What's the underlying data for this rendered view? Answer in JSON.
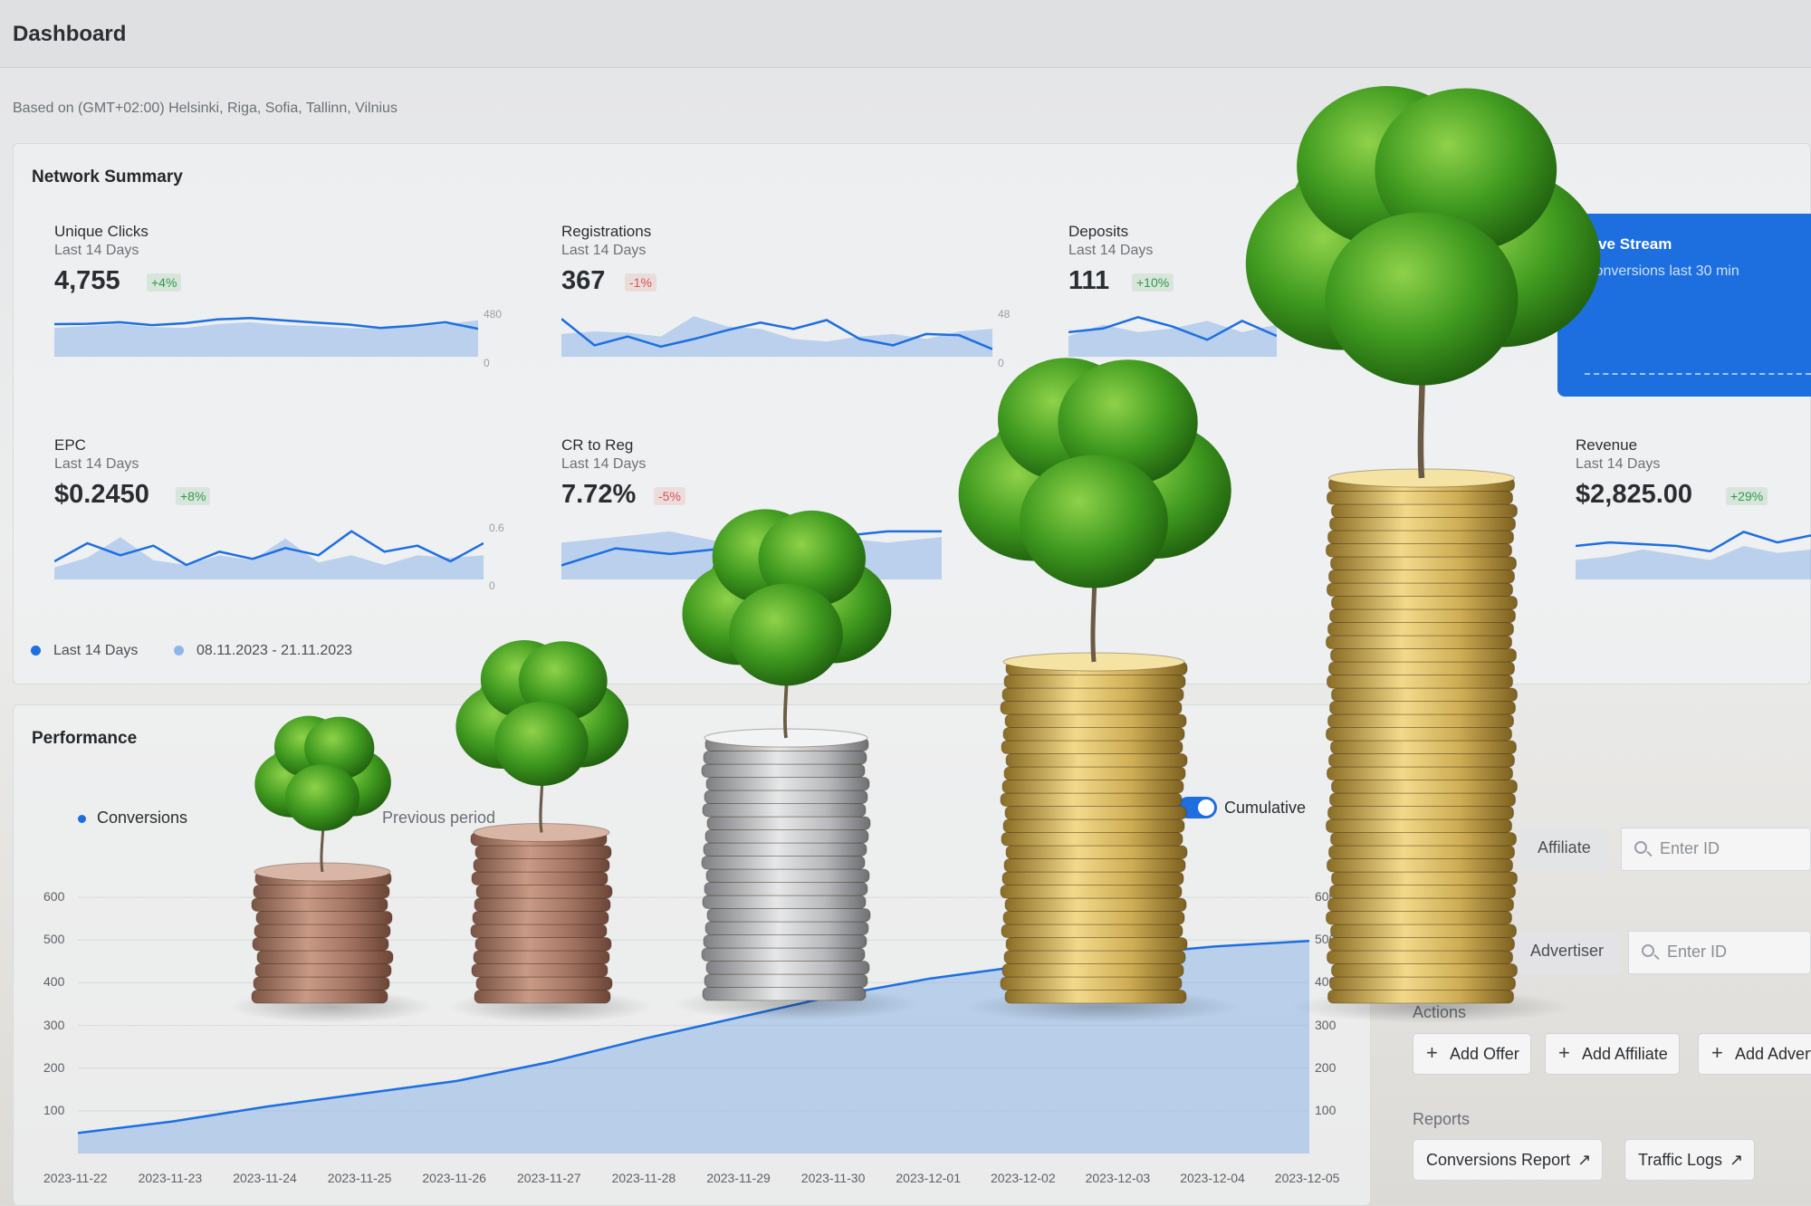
{
  "header": {
    "title": "Dashboard"
  },
  "timezone_note": "Based on (GMT+02:00) Helsinki, Riga, Sofia, Tallinn, Vilnius",
  "network_summary": {
    "title": "Network Summary",
    "metrics": [
      {
        "title": "Unique Clicks",
        "period": "Last 14 Days",
        "value": "4,755",
        "delta": "+4%",
        "trend": "up",
        "axis_max": "480",
        "axis_min": "0",
        "series_current": [
          320,
          322,
          330,
          315,
          325,
          345,
          352,
          340,
          328,
          318,
          300,
          312,
          330,
          295
        ],
        "series_previous": [
          300,
          310,
          320,
          305,
          300,
          320,
          330,
          315,
          310,
          300,
          295,
          305,
          320,
          340
        ]
      },
      {
        "title": "Registrations",
        "period": "Last 14 Days",
        "value": "367",
        "delta": "-1%",
        "trend": "down",
        "axis_max": "48",
        "axis_min": "0",
        "series_current": [
          36,
          15,
          22,
          14,
          20,
          27,
          33,
          28,
          35,
          20,
          15,
          24,
          23,
          12
        ],
        "series_previous": [
          24,
          26,
          25,
          22,
          38,
          30,
          28,
          20,
          18,
          22,
          24,
          20,
          26,
          28
        ]
      },
      {
        "title": "Deposits",
        "period": "Last 14 Days",
        "value": "111",
        "delta": "+10%",
        "trend": "up",
        "axis_max": "",
        "axis_min": "",
        "series_current": [
          22,
          24,
          30,
          25,
          18,
          28,
          20
        ],
        "series_previous": [
          20,
          26,
          22,
          24,
          28,
          22,
          26
        ]
      },
      {
        "title": "EPC",
        "period": "Last 14 Days",
        "value": "$0.2450",
        "delta": "+8%",
        "trend": "up",
        "axis_max": "0.6",
        "axis_min": "0",
        "series_current": [
          0.25,
          0.4,
          0.3,
          0.38,
          0.22,
          0.33,
          0.27,
          0.36,
          0.3,
          0.5,
          0.33,
          0.38,
          0.25,
          0.4
        ],
        "series_previous": [
          0.2,
          0.28,
          0.45,
          0.26,
          0.22,
          0.3,
          0.26,
          0.44,
          0.24,
          0.3,
          0.22,
          0.3,
          0.28,
          0.3
        ]
      },
      {
        "title": "CR to Reg",
        "period": "Last 14 Days",
        "value": "7.72%",
        "delta": "-5%",
        "trend": "down",
        "axis_max": "",
        "axis_min": "",
        "series_current": [
          5,
          8,
          7,
          8,
          9,
          10,
          11,
          11
        ],
        "series_previous": [
          9,
          10,
          11,
          9,
          8,
          10,
          9,
          10
        ]
      },
      {
        "title": "Revenue",
        "period": "Last 14 Days",
        "value": "$2,825.00",
        "delta": "+29%",
        "trend": "up",
        "axis_max": "80",
        "axis_min": "0",
        "series_current": [
          30,
          32,
          31,
          30,
          27,
          38,
          32,
          36
        ],
        "series_previous": [
          22,
          24,
          28,
          25,
          22,
          30,
          26,
          28
        ]
      }
    ],
    "legend": [
      {
        "label": "Last 14 Days",
        "color": "#1d6fe0"
      },
      {
        "label": "08.11.2023 - 21.11.2023",
        "color": "#8fb6e8"
      }
    ]
  },
  "live_stream": {
    "title": "Live Stream",
    "subtitle": "Conversions last 30 min"
  },
  "performance": {
    "title": "Performance",
    "legend_conversions": "Conversions",
    "legend_previous": "Previous period",
    "cumulative_label": "Cumulative",
    "cumulative_on": true,
    "y_ticks": [
      "600",
      "500",
      "400",
      "300",
      "200",
      "100"
    ],
    "y2_ticks": [
      "600",
      "500",
      "400",
      "300",
      "200",
      "100"
    ],
    "x_ticks": [
      "2023-11-22",
      "2023-11-23",
      "2023-11-24",
      "2023-11-25",
      "2023-11-26",
      "2023-11-27",
      "2023-11-28",
      "2023-11-29",
      "2023-11-30",
      "2023-12-01",
      "2023-12-02",
      "2023-12-03",
      "2023-12-04",
      "2023-12-05"
    ]
  },
  "chart_data": {
    "type": "area",
    "title": "Performance",
    "series": [
      {
        "name": "Conversions",
        "values": [
          48,
          75,
          110,
          140,
          170,
          215,
          270,
          320,
          370,
          410,
          440,
          465,
          485,
          498
        ]
      }
    ],
    "categories": [
      "2023-11-22",
      "2023-11-23",
      "2023-11-24",
      "2023-11-25",
      "2023-11-26",
      "2023-11-27",
      "2023-11-28",
      "2023-11-29",
      "2023-11-30",
      "2023-12-01",
      "2023-12-02",
      "2023-12-03",
      "2023-12-04",
      "2023-12-05"
    ],
    "ylim": [
      0,
      600
    ]
  },
  "filters": {
    "affiliate_label": "Affiliate",
    "affiliate_placeholder": "Enter ID",
    "advertiser_label": "Advertiser",
    "advertiser_placeholder": "Enter ID"
  },
  "actions": {
    "title": "Actions",
    "buttons": [
      "Add Offer",
      "Add Affiliate",
      "Add Advertiser"
    ]
  },
  "reports": {
    "title": "Reports",
    "buttons": [
      "Conversions Report",
      "Traffic Logs"
    ]
  },
  "colors": {
    "accent": "#1d6fe0",
    "positive": "#2f9a4a",
    "negative": "#d9534f",
    "area": "#8fb6e8"
  }
}
